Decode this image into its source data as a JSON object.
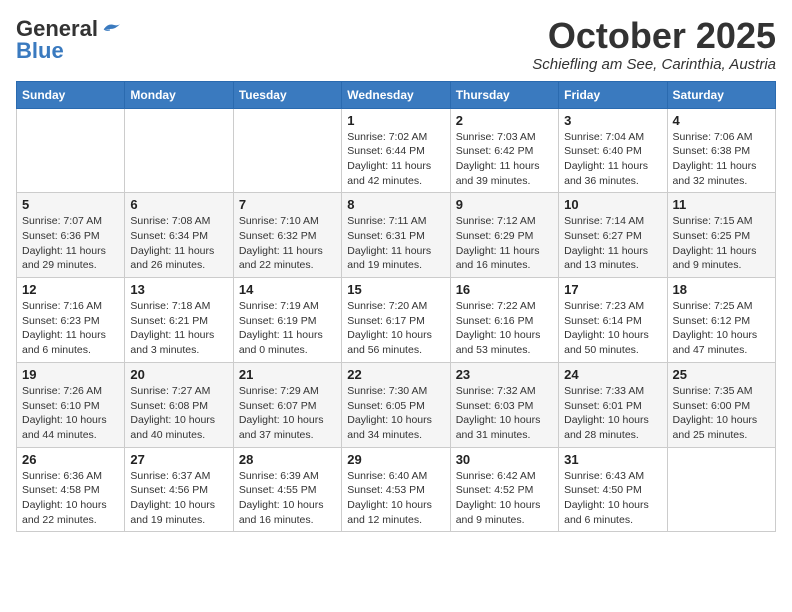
{
  "header": {
    "logo_general": "General",
    "logo_blue": "Blue",
    "month_title": "October 2025",
    "subtitle": "Schiefling am See, Carinthia, Austria"
  },
  "days_of_week": [
    "Sunday",
    "Monday",
    "Tuesday",
    "Wednesday",
    "Thursday",
    "Friday",
    "Saturday"
  ],
  "weeks": [
    [
      {
        "day": "",
        "info": ""
      },
      {
        "day": "",
        "info": ""
      },
      {
        "day": "",
        "info": ""
      },
      {
        "day": "1",
        "info": "Sunrise: 7:02 AM\nSunset: 6:44 PM\nDaylight: 11 hours and 42 minutes."
      },
      {
        "day": "2",
        "info": "Sunrise: 7:03 AM\nSunset: 6:42 PM\nDaylight: 11 hours and 39 minutes."
      },
      {
        "day": "3",
        "info": "Sunrise: 7:04 AM\nSunset: 6:40 PM\nDaylight: 11 hours and 36 minutes."
      },
      {
        "day": "4",
        "info": "Sunrise: 7:06 AM\nSunset: 6:38 PM\nDaylight: 11 hours and 32 minutes."
      }
    ],
    [
      {
        "day": "5",
        "info": "Sunrise: 7:07 AM\nSunset: 6:36 PM\nDaylight: 11 hours and 29 minutes."
      },
      {
        "day": "6",
        "info": "Sunrise: 7:08 AM\nSunset: 6:34 PM\nDaylight: 11 hours and 26 minutes."
      },
      {
        "day": "7",
        "info": "Sunrise: 7:10 AM\nSunset: 6:32 PM\nDaylight: 11 hours and 22 minutes."
      },
      {
        "day": "8",
        "info": "Sunrise: 7:11 AM\nSunset: 6:31 PM\nDaylight: 11 hours and 19 minutes."
      },
      {
        "day": "9",
        "info": "Sunrise: 7:12 AM\nSunset: 6:29 PM\nDaylight: 11 hours and 16 minutes."
      },
      {
        "day": "10",
        "info": "Sunrise: 7:14 AM\nSunset: 6:27 PM\nDaylight: 11 hours and 13 minutes."
      },
      {
        "day": "11",
        "info": "Sunrise: 7:15 AM\nSunset: 6:25 PM\nDaylight: 11 hours and 9 minutes."
      }
    ],
    [
      {
        "day": "12",
        "info": "Sunrise: 7:16 AM\nSunset: 6:23 PM\nDaylight: 11 hours and 6 minutes."
      },
      {
        "day": "13",
        "info": "Sunrise: 7:18 AM\nSunset: 6:21 PM\nDaylight: 11 hours and 3 minutes."
      },
      {
        "day": "14",
        "info": "Sunrise: 7:19 AM\nSunset: 6:19 PM\nDaylight: 11 hours and 0 minutes."
      },
      {
        "day": "15",
        "info": "Sunrise: 7:20 AM\nSunset: 6:17 PM\nDaylight: 10 hours and 56 minutes."
      },
      {
        "day": "16",
        "info": "Sunrise: 7:22 AM\nSunset: 6:16 PM\nDaylight: 10 hours and 53 minutes."
      },
      {
        "day": "17",
        "info": "Sunrise: 7:23 AM\nSunset: 6:14 PM\nDaylight: 10 hours and 50 minutes."
      },
      {
        "day": "18",
        "info": "Sunrise: 7:25 AM\nSunset: 6:12 PM\nDaylight: 10 hours and 47 minutes."
      }
    ],
    [
      {
        "day": "19",
        "info": "Sunrise: 7:26 AM\nSunset: 6:10 PM\nDaylight: 10 hours and 44 minutes."
      },
      {
        "day": "20",
        "info": "Sunrise: 7:27 AM\nSunset: 6:08 PM\nDaylight: 10 hours and 40 minutes."
      },
      {
        "day": "21",
        "info": "Sunrise: 7:29 AM\nSunset: 6:07 PM\nDaylight: 10 hours and 37 minutes."
      },
      {
        "day": "22",
        "info": "Sunrise: 7:30 AM\nSunset: 6:05 PM\nDaylight: 10 hours and 34 minutes."
      },
      {
        "day": "23",
        "info": "Sunrise: 7:32 AM\nSunset: 6:03 PM\nDaylight: 10 hours and 31 minutes."
      },
      {
        "day": "24",
        "info": "Sunrise: 7:33 AM\nSunset: 6:01 PM\nDaylight: 10 hours and 28 minutes."
      },
      {
        "day": "25",
        "info": "Sunrise: 7:35 AM\nSunset: 6:00 PM\nDaylight: 10 hours and 25 minutes."
      }
    ],
    [
      {
        "day": "26",
        "info": "Sunrise: 6:36 AM\nSunset: 4:58 PM\nDaylight: 10 hours and 22 minutes."
      },
      {
        "day": "27",
        "info": "Sunrise: 6:37 AM\nSunset: 4:56 PM\nDaylight: 10 hours and 19 minutes."
      },
      {
        "day": "28",
        "info": "Sunrise: 6:39 AM\nSunset: 4:55 PM\nDaylight: 10 hours and 16 minutes."
      },
      {
        "day": "29",
        "info": "Sunrise: 6:40 AM\nSunset: 4:53 PM\nDaylight: 10 hours and 12 minutes."
      },
      {
        "day": "30",
        "info": "Sunrise: 6:42 AM\nSunset: 4:52 PM\nDaylight: 10 hours and 9 minutes."
      },
      {
        "day": "31",
        "info": "Sunrise: 6:43 AM\nSunset: 4:50 PM\nDaylight: 10 hours and 6 minutes."
      },
      {
        "day": "",
        "info": ""
      }
    ]
  ]
}
